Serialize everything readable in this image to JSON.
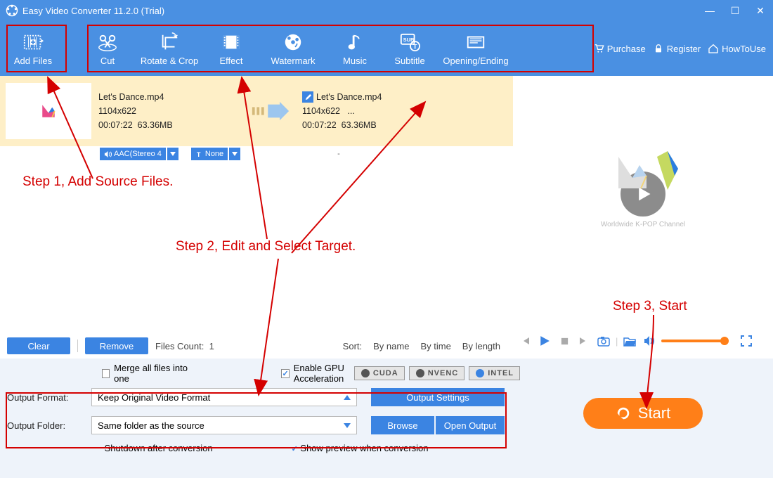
{
  "app": {
    "title": "Easy Video Converter 11.2.0 (Trial)"
  },
  "toolbar": {
    "add_files": "Add Files",
    "cut": "Cut",
    "rotate_crop": "Rotate & Crop",
    "effect": "Effect",
    "watermark": "Watermark",
    "music": "Music",
    "subtitle": "Subtitle",
    "opening_ending": "Opening/Ending",
    "purchase": "Purchase",
    "register": "Register",
    "howtouse": "HowToUse"
  },
  "file": {
    "source_name": "Let's Dance.mp4",
    "target_name": "Let's Dance.mp4",
    "dimensions": "1104x622",
    "duration": "00:07:22",
    "size": "63.36MB",
    "ellipsis": "...",
    "audio_tag": "AAC(Stereo 4",
    "subtitle_tag": "None",
    "dash": "-"
  },
  "annotations": {
    "step1": "Step 1, Add Source Files.",
    "step2": "Step 2, Edit and Select Target.",
    "step3": "Step 3, Start"
  },
  "actions": {
    "clear": "Clear",
    "remove": "Remove",
    "files_count_label": "Files Count:",
    "files_count": "1",
    "sort_label": "Sort:",
    "by_name": "By name",
    "by_time": "By time",
    "by_length": "By length"
  },
  "preview": {
    "watermark_text": "Worldwide K-POP Channel"
  },
  "bottom": {
    "merge": "Merge all files into one",
    "gpu": "Enable GPU Acceleration",
    "cuda": "CUDA",
    "nvenc": "NVENC",
    "intel": "INTEL",
    "output_format_label": "Output Format:",
    "output_format_value": "Keep Original Video Format",
    "output_settings": "Output Settings",
    "output_folder_label": "Output Folder:",
    "output_folder_value": "Same folder as the source",
    "browse": "Browse",
    "open_output": "Open Output",
    "shutdown": "Shutdown after conversion",
    "show_preview": "Show preview when conversion",
    "start": "Start"
  }
}
